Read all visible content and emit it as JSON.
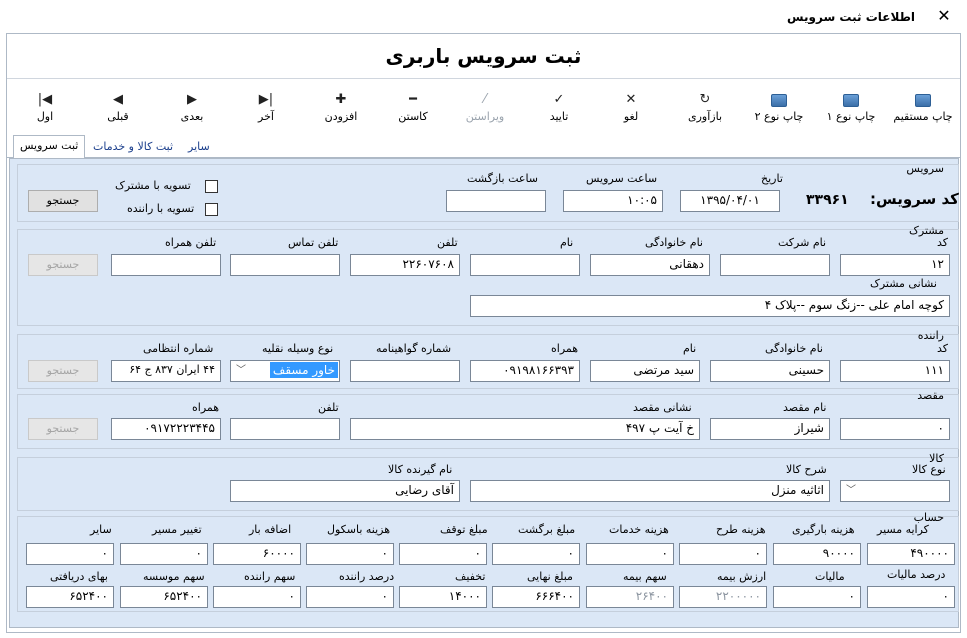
{
  "window": {
    "title": "اطلاعات ثبت سرویس",
    "close": "✕"
  },
  "banner": {
    "title": "ثبت سرویس باربری"
  },
  "toolbar": {
    "print_direct": "چاپ مستقیم",
    "print_type1": "چاپ نوع ۱",
    "print_type2": "چاپ نوع ۲",
    "reload": "بازآوری",
    "cancel": "لغو",
    "confirm": "تایید",
    "edit": "ویراستن",
    "reduce": "کاستن",
    "add": "افزودن",
    "last": "آخر",
    "next": "بعدی",
    "prev": "قبلی",
    "first": "اول"
  },
  "tabs": [
    "ثبت سرویس",
    "ثبت کالا و خدمات",
    "سایر"
  ],
  "service": {
    "group": "سرویس",
    "code_label": "کد سرویس:",
    "code_value": "۳۳۹۶۱",
    "date_label": "تاریخ",
    "date_value": "۱۳۹۵/۰۴/۰۱",
    "time_label": "ساعت سرویس",
    "time_value": "۱۰:۰۵",
    "return_label": "ساعت بازگشت",
    "return_value": "",
    "settle_customer": "تسویه با مشترک",
    "settle_driver": "تسویه با راننده",
    "search": "جستجو"
  },
  "customer": {
    "group": "مشترک",
    "code_label": "کد",
    "code_value": "۱۲",
    "company_label": "نام شرکت",
    "company_value": "",
    "family_label": "نام خانوادگی",
    "family_value": "دهقانی",
    "name_label": "نام",
    "name_value": "",
    "phone_label": "تلفن",
    "phone_value": "۲۲۶۰۷۶۰۸",
    "contact_label": "تلفن تماس",
    "contact_value": "",
    "mobile_label": "تلفن همراه",
    "mobile_value": "",
    "address_label": "نشانی مشترک",
    "address_value": "کوچه امام علی --زنگ سوم --پلاک ۴",
    "search": "جستجو"
  },
  "driver": {
    "group": "راننده",
    "code_label": "کد",
    "code_value": "۱۱۱",
    "family_label": "نام خانوادگی",
    "family_value": "حسینی",
    "name_label": "نام",
    "name_value": "سید مرتضی",
    "mobile_label": "همراه",
    "mobile_value": "۰۹۱۹۸۱۶۶۳۹۳",
    "cert_label": "شماره گواهینامه",
    "cert_value": "",
    "vehicle_label": "نوع وسیله نقلیه",
    "vehicle_value": "خاور مسقف",
    "plate_label": "شماره انتظامی",
    "plate_value": "۴۴ ایران ۸۳۷ ج ۶۴",
    "search": "جستجو"
  },
  "destination": {
    "group": "مقصد",
    "code_value": "۰",
    "name_label": "نام مقصد",
    "name_value": "شیراز",
    "address_label": "نشانی مقصد",
    "address_value": "خ آیت پ ۴۹۷",
    "phone_label": "تلفن",
    "phone_value": "",
    "mobile_label": "همراه",
    "mobile_value": "۰۹۱۷۲۲۲۳۴۴۵",
    "search": "جستجو"
  },
  "goods": {
    "group": "کالا",
    "type_label": "نوع کالا",
    "type_value": "",
    "desc_label": "شرح کالا",
    "desc_value": "اثاثیه منزل",
    "receiver_label": "نام گیرنده کالا",
    "receiver_value": "آقای رضایی"
  },
  "account": {
    "group": "حساب",
    "row1": [
      {
        "label": "کرایه مسیر",
        "value": "۴۹۰۰۰۰"
      },
      {
        "label": "هزینه بارگیری",
        "value": "۹۰۰۰۰"
      },
      {
        "label": "هزینه طرح",
        "value": "۰"
      },
      {
        "label": "هزینه خدمات",
        "value": "۰"
      },
      {
        "label": "مبلغ برگشت",
        "value": "۰"
      },
      {
        "label": "مبلغ توقف",
        "value": "۰"
      },
      {
        "label": "هزینه باسکول",
        "value": "۰"
      },
      {
        "label": "اضافه بار",
        "value": "۶۰۰۰۰"
      },
      {
        "label": "تغییر مسیر",
        "value": "۰"
      },
      {
        "label": "سایر",
        "value": "۰"
      }
    ],
    "row2": [
      {
        "label": "درصد مالیات",
        "value": "۰"
      },
      {
        "label": "مالیات",
        "value": "۰"
      },
      {
        "label": "ارزش بیمه",
        "value": "۲۲۰۰۰۰۰"
      },
      {
        "label": "سهم بیمه",
        "value": "۲۶۴۰۰"
      },
      {
        "label": "مبلغ نهایی",
        "value": "۶۶۶۴۰۰"
      },
      {
        "label": "تخفیف",
        "value": "۱۴۰۰۰"
      },
      {
        "label": "درصد راننده",
        "value": "۰"
      },
      {
        "label": "سهم راننده",
        "value": "۰"
      },
      {
        "label": "سهم موسسه",
        "value": "۶۵۲۴۰۰"
      },
      {
        "label": "بهای دریافتی",
        "value": "۶۵۲۴۰۰"
      }
    ]
  }
}
